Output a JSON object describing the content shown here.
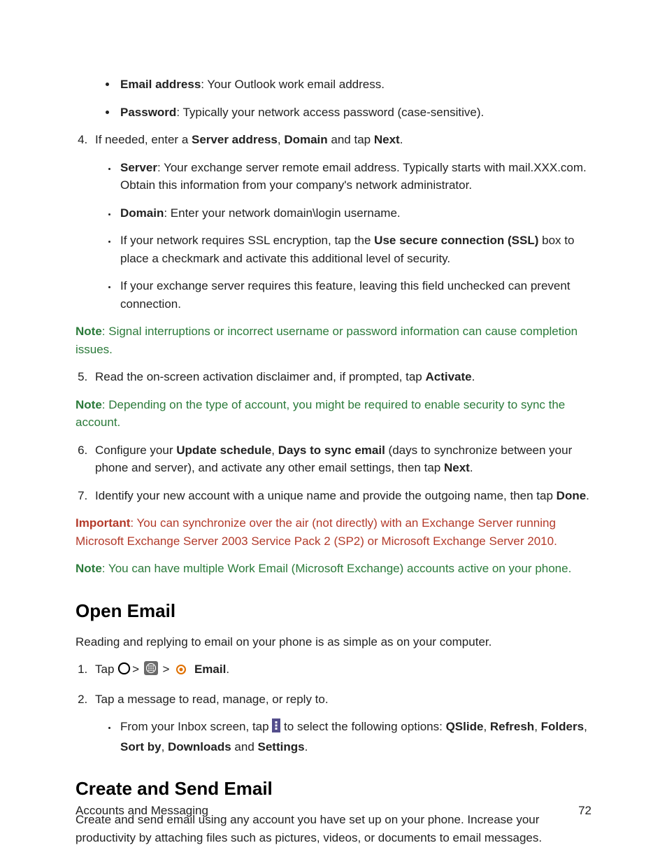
{
  "bullets_top": [
    {
      "label": "Email address",
      "text": ": Your Outlook work email address."
    },
    {
      "label": "Password",
      "text": ": Typically your network access password (case-sensitive)."
    }
  ],
  "step4": {
    "prefix": "If needed, enter a ",
    "b1": "Server address",
    "sep1": ", ",
    "b2": "Domain",
    "mid": " and tap ",
    "b3": "Next",
    "suffix": "."
  },
  "step4_sub": [
    {
      "label": "Server",
      "text": ": Your exchange server remote email address. Typically starts with mail.XXX.com. Obtain this information from your company's network administrator."
    },
    {
      "label": "Domain",
      "text": ": Enter your network domain\\login username."
    }
  ],
  "step4_extra1": {
    "pre": "If your network requires SSL encryption, tap the ",
    "bold": "Use secure connection (SSL)",
    "post": " box to place a checkmark and activate this additional level of security."
  },
  "step4_extra2": "If your exchange server requires this feature, leaving this field unchecked can prevent connection.",
  "note1": {
    "label": "Note",
    "text": ": Signal interruptions or incorrect username or password information can cause completion issues."
  },
  "step5": {
    "pre": "Read the on-screen activation disclaimer and, if prompted, tap ",
    "bold": "Activate",
    "post": "."
  },
  "note2": {
    "label": "Note",
    "text": ": Depending on the type of account, you might be required to enable security to sync the account."
  },
  "step6": {
    "pre": "Configure your ",
    "b1": "Update schedule",
    "sep1": ", ",
    "b2": "Days to sync email",
    "mid": " (days to synchronize between your phone and server), and activate any other email settings, then tap ",
    "b3": "Next",
    "post": "."
  },
  "step7": {
    "pre": "Identify your new account with a unique name and provide the outgoing name, then tap ",
    "bold": "Done",
    "post": "."
  },
  "important": {
    "label": "Important",
    "text": ": You can synchronize over the air (not directly) with an Exchange Server running Microsoft Exchange Server 2003 Service Pack 2 (SP2) or Microsoft Exchange Server 2010."
  },
  "note3": {
    "label": "Note",
    "text": ": You can have multiple Work Email (Microsoft Exchange) accounts active on your phone."
  },
  "h_open": "Open Email",
  "open_intro": "Reading and replying to email on your phone is as simple as on your computer.",
  "open_step1": {
    "tap": "Tap ",
    "gt": ">",
    "email": "Email",
    "dot": "."
  },
  "open_step2": "Tap a message to read, manage, or reply to.",
  "open_sub": {
    "pre": "From your Inbox screen, tap ",
    "mid": " to select the following options: ",
    "o1": "QSlide",
    "c1": ", ",
    "o2": "Refresh",
    "c2": ", ",
    "o3": "Folders",
    "c3": ", ",
    "o4": "Sort by",
    "c4": ", ",
    "o5": "Downloads",
    "c5": " and ",
    "o6": "Settings",
    "c6": "."
  },
  "h_create": "Create and Send Email",
  "create_intro": "Create and send email using any account you have set up on your phone. Increase your productivity by attaching files such as pictures, videos, or documents to email messages.",
  "footer": {
    "section": "Accounts and Messaging",
    "page": "72"
  }
}
